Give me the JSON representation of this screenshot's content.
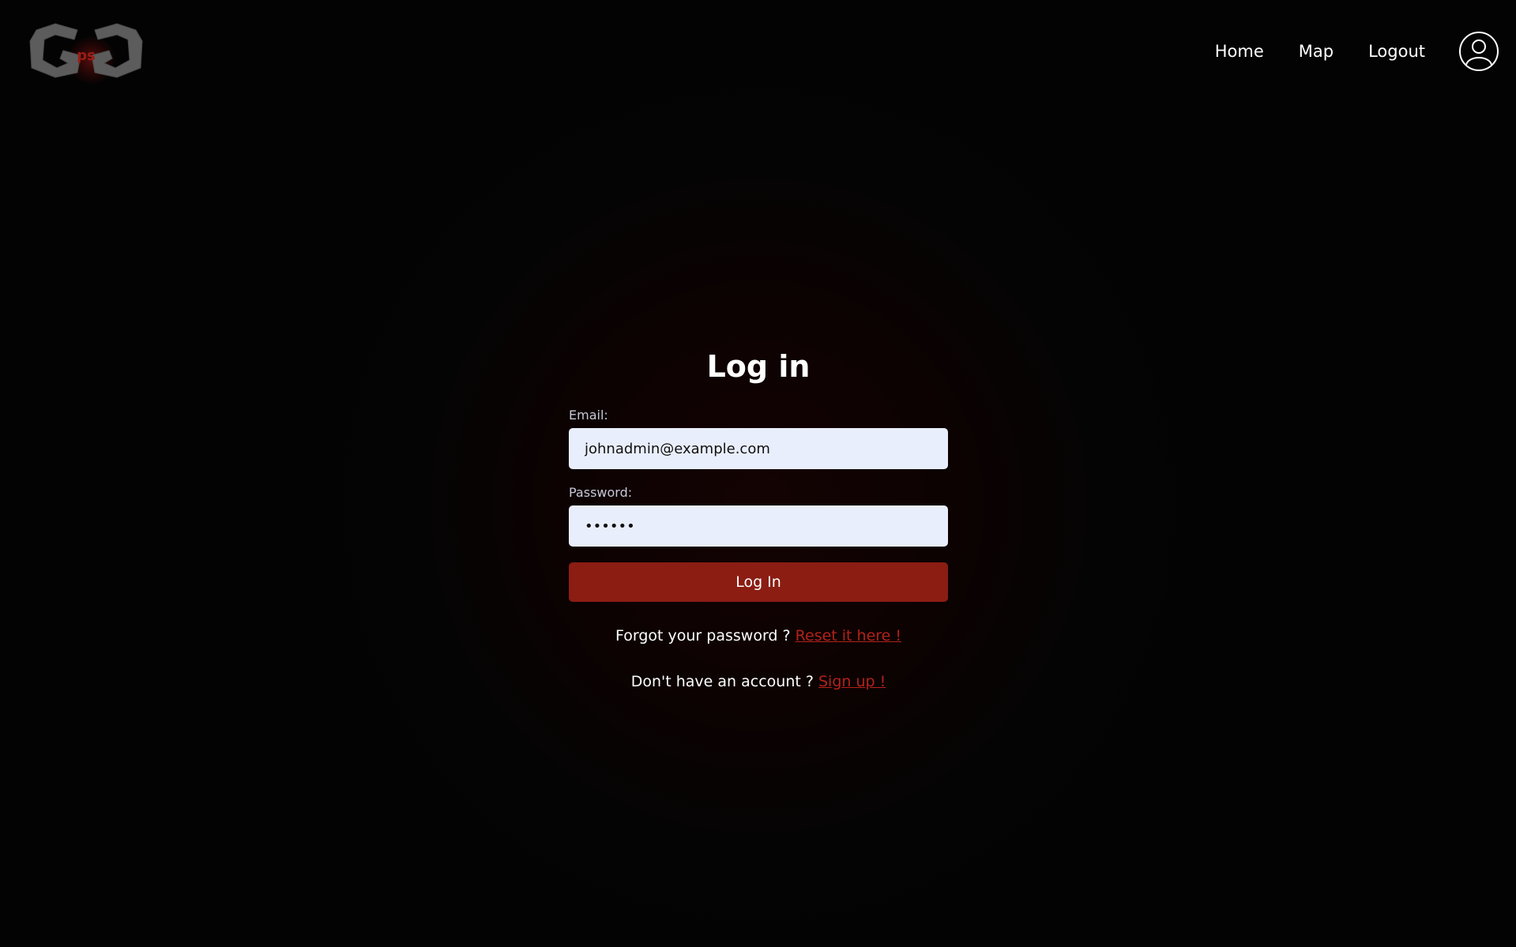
{
  "nav": {
    "links": [
      "Home",
      "Map",
      "Logout"
    ]
  },
  "logo": {
    "label": "ps"
  },
  "login": {
    "title": "Log in",
    "email_label": "Email:",
    "email_value": "johnadmin@example.com",
    "password_label": "Password:",
    "password_value": "••••••",
    "submit_label": "Log In",
    "forgot_text": "Forgot your password ?",
    "forgot_link": "Reset it here !",
    "signup_text": "Don't have an account ?",
    "signup_link": "Sign up !"
  },
  "icons": {
    "logo": "gps-logo-icon",
    "avatar": "user-avatar-icon"
  },
  "colors": {
    "background": "#030303",
    "accent": "#8b1d13",
    "link": "#b2221a",
    "input_bg": "#e9eefc"
  }
}
